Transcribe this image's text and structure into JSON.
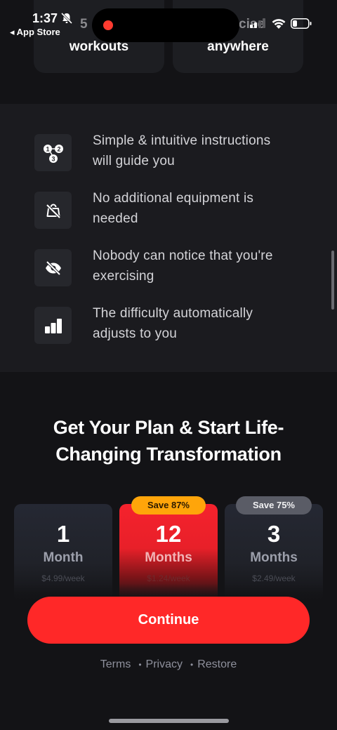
{
  "status_bar": {
    "time": "1:37",
    "back_label": "◂ App Store",
    "peek_left": "5",
    "peek_right": "cise"
  },
  "top_tiles": {
    "left_text": "workouts",
    "right_text": "anywhere"
  },
  "features": [
    {
      "icon": "numbered-steps-icon",
      "text_line1": "Simple & intuitive instructions",
      "text_line2": "will guide you"
    },
    {
      "icon": "no-weight-icon",
      "text_line1": "No additional equipment is",
      "text_line2": "needed"
    },
    {
      "icon": "eye-off-icon",
      "text_line1": "Nobody can notice that you're",
      "text_line2": "exercising"
    },
    {
      "icon": "bar-chart-icon",
      "text_line1": "The difficulty automatically",
      "text_line2": "adjusts to you"
    }
  ],
  "plan_section": {
    "title_line1": "Get Your Plan & Start Life-",
    "title_line2": "Changing Transformation"
  },
  "plans": [
    {
      "number": "1",
      "unit": "Month",
      "price": "$4.99/week",
      "badge": "",
      "selected": false
    },
    {
      "number": "12",
      "unit": "Months",
      "price": "$1.24/week",
      "badge": "Save 87%",
      "selected": true
    },
    {
      "number": "3",
      "unit": "Months",
      "price": "$2.49/week",
      "badge": "Save 75%",
      "selected": false
    }
  ],
  "continue_label": "Continue",
  "links": {
    "terms": "Terms",
    "privacy": "Privacy",
    "restore": "Restore",
    "separator": "•"
  },
  "colors": {
    "accent": "#ff2828",
    "badge_orange": "#ffa50a",
    "badge_grey": "#5a5c66",
    "background": "#131316"
  }
}
